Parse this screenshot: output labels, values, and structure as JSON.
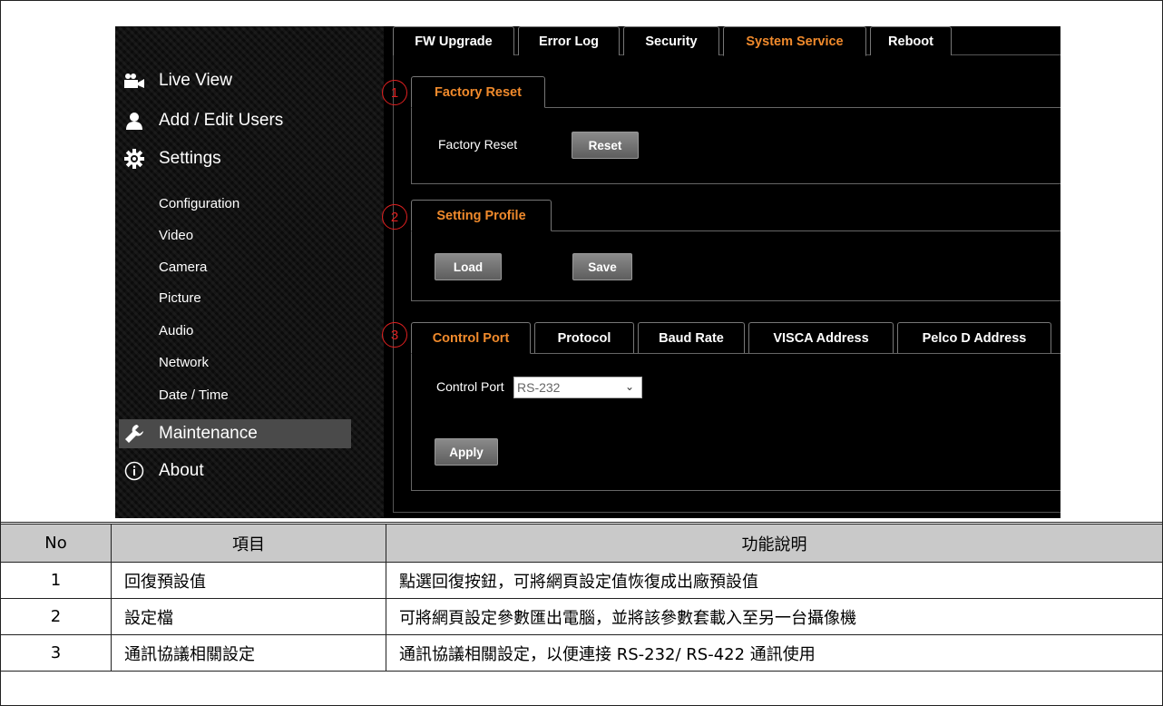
{
  "tabs": [
    "FW Upgrade",
    "Error Log",
    "Security",
    "System Service",
    "Reboot"
  ],
  "sidebar": {
    "main": [
      {
        "label": "Live View",
        "icon": "video-camera-icon"
      },
      {
        "label": "Add / Edit Users",
        "icon": "user-icon"
      },
      {
        "label": "Settings",
        "icon": "gear-icon"
      },
      {
        "label": "Maintenance",
        "icon": "wrench-icon"
      },
      {
        "label": "About",
        "icon": "info-icon"
      }
    ],
    "sub": [
      "Configuration",
      "Video",
      "Camera",
      "Picture",
      "Audio",
      "Network",
      "Date / Time"
    ]
  },
  "factory_reset": {
    "tab": "Factory Reset",
    "label": "Factory Reset",
    "button": "Reset",
    "marker": "1"
  },
  "setting_profile": {
    "tab": "Setting Profile",
    "load": "Load",
    "save": "Save",
    "marker": "2"
  },
  "control": {
    "tabs": [
      "Control Port",
      "Protocol",
      "Baud Rate",
      "VISCA Address",
      "Pelco D Address"
    ],
    "label": "Control Port",
    "select_value": "RS-232",
    "apply": "Apply",
    "marker": "3"
  },
  "table": {
    "headers": [
      "No",
      "項目",
      "功能說明"
    ],
    "rows": [
      [
        "1",
        "回復預設值",
        "點選回復按鈕，可將網頁設定值恢復成出廠預設值"
      ],
      [
        "2",
        "設定檔",
        "可將網頁設定參數匯出電腦，並將該參數套載入至另一台攝像機"
      ],
      [
        "3",
        "通訊協議相關設定",
        "通訊協議相關設定，以便連接 RS-232/ RS-422 通訊使用"
      ]
    ]
  },
  "colors": {
    "active_tab": "#f08a2c",
    "marker": "#e02020",
    "header_bg": "#c9c9c9"
  }
}
